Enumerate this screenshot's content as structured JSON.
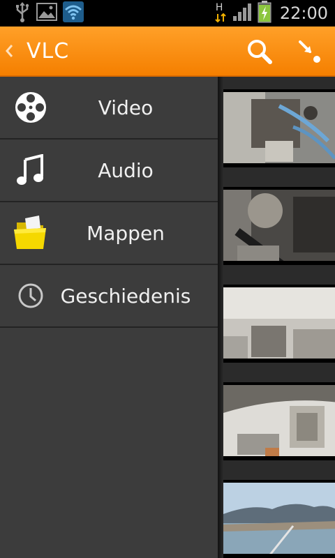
{
  "status_bar": {
    "time": "22:00",
    "network_label": "H",
    "icons": [
      "usb-icon",
      "image-notification-icon",
      "wifi-icon",
      "signal-icon",
      "battery-charging-icon"
    ]
  },
  "action_bar": {
    "title": "VLC",
    "back_icon": "chevron-left-icon",
    "actions": [
      "search-icon",
      "direct-play-icon"
    ],
    "accent_color": "#f57f00"
  },
  "menu": {
    "items": [
      {
        "label": "Video",
        "icon": "film-reel-icon"
      },
      {
        "label": "Audio",
        "icon": "music-note-icon"
      },
      {
        "label": "Mappen",
        "icon": "folder-icon"
      },
      {
        "label": "Geschiedenis",
        "icon": "clock-icon"
      }
    ]
  },
  "video_list": {
    "thumbnails": [
      "engine-thumb-1",
      "engine-thumb-2",
      "engine-thumb-3",
      "engine-thumb-4",
      "coastline-thumb"
    ]
  }
}
